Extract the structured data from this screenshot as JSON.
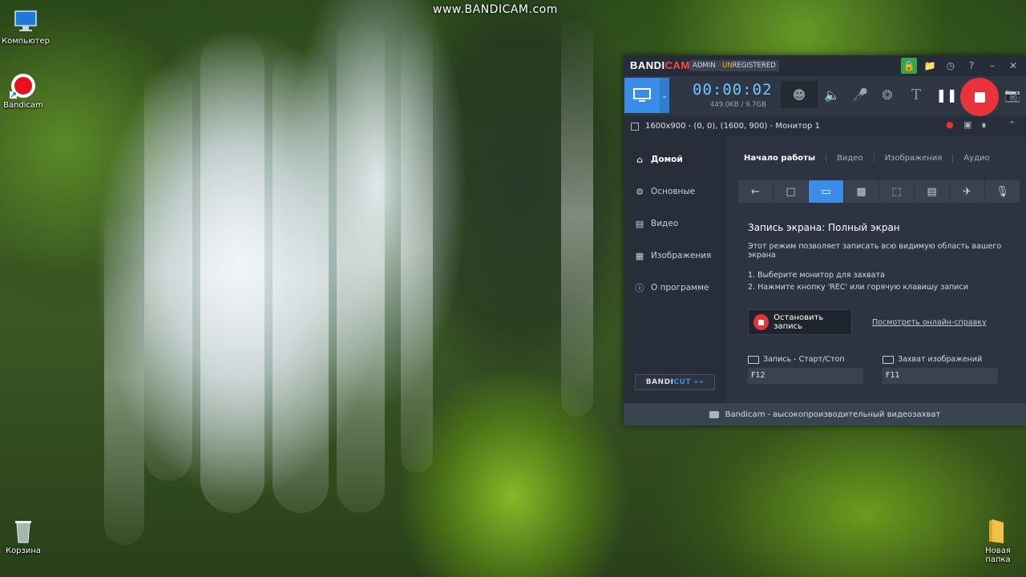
{
  "desktop": {
    "watermark": "www.BANDICAM.com",
    "icons": [
      {
        "label": "Компьютер",
        "icon": "computer-icon"
      },
      {
        "label": "Bandicam",
        "icon": "bandicam-icon"
      },
      {
        "label": "Корзина",
        "icon": "recycle-bin-icon"
      },
      {
        "label": "Новая папка",
        "icon": "folder-icon"
      }
    ]
  },
  "window": {
    "brand": {
      "part1": "BANDI",
      "part2": "CAM"
    },
    "badges": {
      "admin": "ADMIN",
      "unregistered_prefix": "UN",
      "unregistered_rest": "REGISTERED"
    },
    "accent_color": "#3a8ce6",
    "rec_color": "#e8333a"
  },
  "toolbar": {
    "timer": "00:00:02",
    "file_size": "449.0KB / 9.7GB"
  },
  "target_strip": {
    "text": "1600x900 - (0, 0), (1600, 900) - Монитор 1"
  },
  "sidebar": {
    "items": [
      {
        "label": "Домой",
        "icon": "home-icon"
      },
      {
        "label": "Основные",
        "icon": "gear-icon"
      },
      {
        "label": "Видео",
        "icon": "video-icon"
      },
      {
        "label": "Изображения",
        "icon": "image-icon"
      },
      {
        "label": "О программе",
        "icon": "info-icon"
      }
    ],
    "bandicut": {
      "part1": "BANDI",
      "part2": "CUT",
      "arrows": "»»"
    }
  },
  "main": {
    "tabs": [
      "Начало работы",
      "Видео",
      "Изображения",
      "Аудио"
    ],
    "heading": "Запись экрана: Полный экран",
    "description": "Этот режим позволяет записать всю видимую область вашего экрана",
    "steps": [
      "1. Выберите монитор для захвата",
      "2. Нажмите кнопку 'REC' или горячую клавишу записи"
    ],
    "stop_button": "Остановить запись",
    "help_link": "Посмотреть онлайн-справку",
    "hotkeys": [
      {
        "label": "Запись - Старт/Стоп",
        "value": "F12"
      },
      {
        "label": "Захват изображений",
        "value": "F11"
      }
    ]
  },
  "footer": {
    "text": "Bandicam - высокопроизводительный видеозахват"
  }
}
